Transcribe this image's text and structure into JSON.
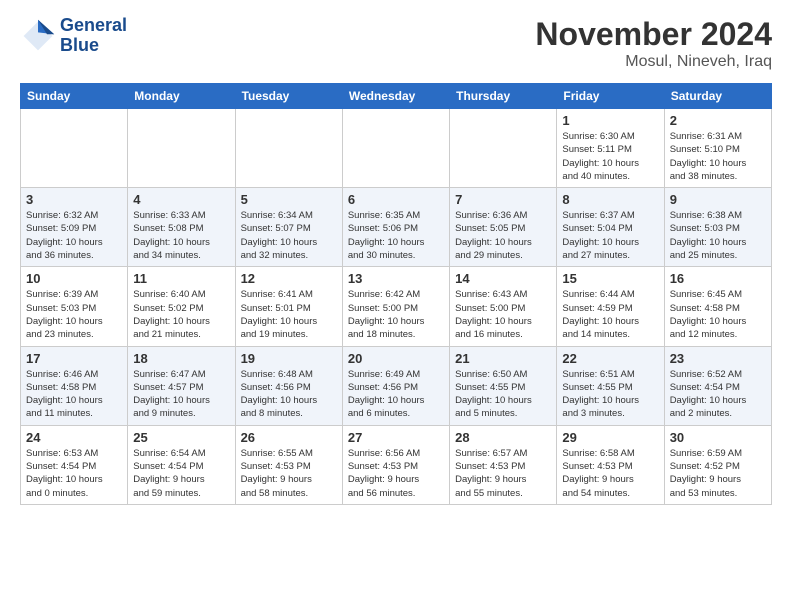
{
  "header": {
    "logo_line1": "General",
    "logo_line2": "Blue",
    "month": "November 2024",
    "location": "Mosul, Nineveh, Iraq"
  },
  "weekdays": [
    "Sunday",
    "Monday",
    "Tuesday",
    "Wednesday",
    "Thursday",
    "Friday",
    "Saturday"
  ],
  "weeks": [
    [
      {
        "day": "",
        "info": ""
      },
      {
        "day": "",
        "info": ""
      },
      {
        "day": "",
        "info": ""
      },
      {
        "day": "",
        "info": ""
      },
      {
        "day": "",
        "info": ""
      },
      {
        "day": "1",
        "info": "Sunrise: 6:30 AM\nSunset: 5:11 PM\nDaylight: 10 hours\nand 40 minutes."
      },
      {
        "day": "2",
        "info": "Sunrise: 6:31 AM\nSunset: 5:10 PM\nDaylight: 10 hours\nand 38 minutes."
      }
    ],
    [
      {
        "day": "3",
        "info": "Sunrise: 6:32 AM\nSunset: 5:09 PM\nDaylight: 10 hours\nand 36 minutes."
      },
      {
        "day": "4",
        "info": "Sunrise: 6:33 AM\nSunset: 5:08 PM\nDaylight: 10 hours\nand 34 minutes."
      },
      {
        "day": "5",
        "info": "Sunrise: 6:34 AM\nSunset: 5:07 PM\nDaylight: 10 hours\nand 32 minutes."
      },
      {
        "day": "6",
        "info": "Sunrise: 6:35 AM\nSunset: 5:06 PM\nDaylight: 10 hours\nand 30 minutes."
      },
      {
        "day": "7",
        "info": "Sunrise: 6:36 AM\nSunset: 5:05 PM\nDaylight: 10 hours\nand 29 minutes."
      },
      {
        "day": "8",
        "info": "Sunrise: 6:37 AM\nSunset: 5:04 PM\nDaylight: 10 hours\nand 27 minutes."
      },
      {
        "day": "9",
        "info": "Sunrise: 6:38 AM\nSunset: 5:03 PM\nDaylight: 10 hours\nand 25 minutes."
      }
    ],
    [
      {
        "day": "10",
        "info": "Sunrise: 6:39 AM\nSunset: 5:03 PM\nDaylight: 10 hours\nand 23 minutes."
      },
      {
        "day": "11",
        "info": "Sunrise: 6:40 AM\nSunset: 5:02 PM\nDaylight: 10 hours\nand 21 minutes."
      },
      {
        "day": "12",
        "info": "Sunrise: 6:41 AM\nSunset: 5:01 PM\nDaylight: 10 hours\nand 19 minutes."
      },
      {
        "day": "13",
        "info": "Sunrise: 6:42 AM\nSunset: 5:00 PM\nDaylight: 10 hours\nand 18 minutes."
      },
      {
        "day": "14",
        "info": "Sunrise: 6:43 AM\nSunset: 5:00 PM\nDaylight: 10 hours\nand 16 minutes."
      },
      {
        "day": "15",
        "info": "Sunrise: 6:44 AM\nSunset: 4:59 PM\nDaylight: 10 hours\nand 14 minutes."
      },
      {
        "day": "16",
        "info": "Sunrise: 6:45 AM\nSunset: 4:58 PM\nDaylight: 10 hours\nand 12 minutes."
      }
    ],
    [
      {
        "day": "17",
        "info": "Sunrise: 6:46 AM\nSunset: 4:58 PM\nDaylight: 10 hours\nand 11 minutes."
      },
      {
        "day": "18",
        "info": "Sunrise: 6:47 AM\nSunset: 4:57 PM\nDaylight: 10 hours\nand 9 minutes."
      },
      {
        "day": "19",
        "info": "Sunrise: 6:48 AM\nSunset: 4:56 PM\nDaylight: 10 hours\nand 8 minutes."
      },
      {
        "day": "20",
        "info": "Sunrise: 6:49 AM\nSunset: 4:56 PM\nDaylight: 10 hours\nand 6 minutes."
      },
      {
        "day": "21",
        "info": "Sunrise: 6:50 AM\nSunset: 4:55 PM\nDaylight: 10 hours\nand 5 minutes."
      },
      {
        "day": "22",
        "info": "Sunrise: 6:51 AM\nSunset: 4:55 PM\nDaylight: 10 hours\nand 3 minutes."
      },
      {
        "day": "23",
        "info": "Sunrise: 6:52 AM\nSunset: 4:54 PM\nDaylight: 10 hours\nand 2 minutes."
      }
    ],
    [
      {
        "day": "24",
        "info": "Sunrise: 6:53 AM\nSunset: 4:54 PM\nDaylight: 10 hours\nand 0 minutes."
      },
      {
        "day": "25",
        "info": "Sunrise: 6:54 AM\nSunset: 4:54 PM\nDaylight: 9 hours\nand 59 minutes."
      },
      {
        "day": "26",
        "info": "Sunrise: 6:55 AM\nSunset: 4:53 PM\nDaylight: 9 hours\nand 58 minutes."
      },
      {
        "day": "27",
        "info": "Sunrise: 6:56 AM\nSunset: 4:53 PM\nDaylight: 9 hours\nand 56 minutes."
      },
      {
        "day": "28",
        "info": "Sunrise: 6:57 AM\nSunset: 4:53 PM\nDaylight: 9 hours\nand 55 minutes."
      },
      {
        "day": "29",
        "info": "Sunrise: 6:58 AM\nSunset: 4:53 PM\nDaylight: 9 hours\nand 54 minutes."
      },
      {
        "day": "30",
        "info": "Sunrise: 6:59 AM\nSunset: 4:52 PM\nDaylight: 9 hours\nand 53 minutes."
      }
    ]
  ]
}
